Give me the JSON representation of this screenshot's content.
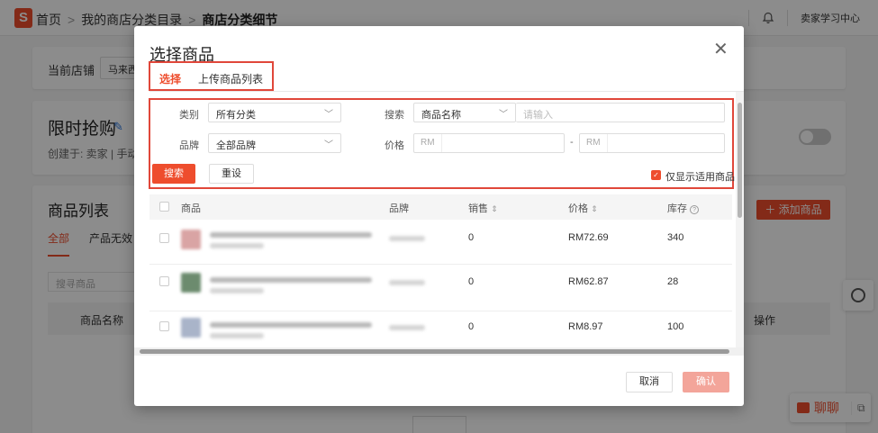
{
  "header": {
    "logo": "S",
    "breadcrumb": [
      "首页",
      "我的商店分类目录",
      "商店分类细节"
    ],
    "seller_center": "卖家学习中心"
  },
  "background": {
    "shop_label": "当前店铺",
    "shop_value": "马来西",
    "flash_title": "限时抢购",
    "created_meta": "创建于:   卖家 | 手动",
    "product_list_title": "商品列表",
    "add_product_label": "添加商品",
    "tabs": [
      "全部",
      "产品无效"
    ],
    "search_placeholder": "搜寻商品",
    "table_headers": [
      "商品名称",
      "操作"
    ],
    "chat_label": "聊聊"
  },
  "modal": {
    "title": "选择商品",
    "tabs": [
      "选择",
      "上传商品列表"
    ],
    "filters": {
      "category_label": "类别",
      "category_value": "所有分类",
      "search_label": "搜索",
      "search_type_value": "商品名称",
      "search_placeholder": "请输入",
      "brand_label": "品牌",
      "brand_value": "全部品牌",
      "price_label": "价格",
      "price_prefix": "RM",
      "price_sep": "-",
      "search_button": "搜索",
      "reset_button": "重设",
      "only_applicable_label": "仅显示适用商品",
      "only_applicable_checked": true
    },
    "table": {
      "headers": [
        "商品",
        "品牌",
        "销售",
        "价格",
        "库存"
      ],
      "rows": [
        {
          "sales": "0",
          "price": "RM72.69",
          "stock": "340"
        },
        {
          "sales": "0",
          "price": "RM62.87",
          "stock": "28"
        },
        {
          "sales": "0",
          "price": "RM8.97",
          "stock": "100"
        }
      ]
    },
    "cancel_button": "取消",
    "confirm_button": "确认"
  },
  "colors": {
    "brand": "#ee4d2d",
    "highlight_box": "#e0473a"
  },
  "icons": [
    "shopee-logo-icon",
    "bell-icon",
    "pencil-icon",
    "chevron-down-icon",
    "close-icon",
    "sort-icon",
    "help-icon",
    "chat-icon",
    "plus-icon",
    "check-icon"
  ]
}
